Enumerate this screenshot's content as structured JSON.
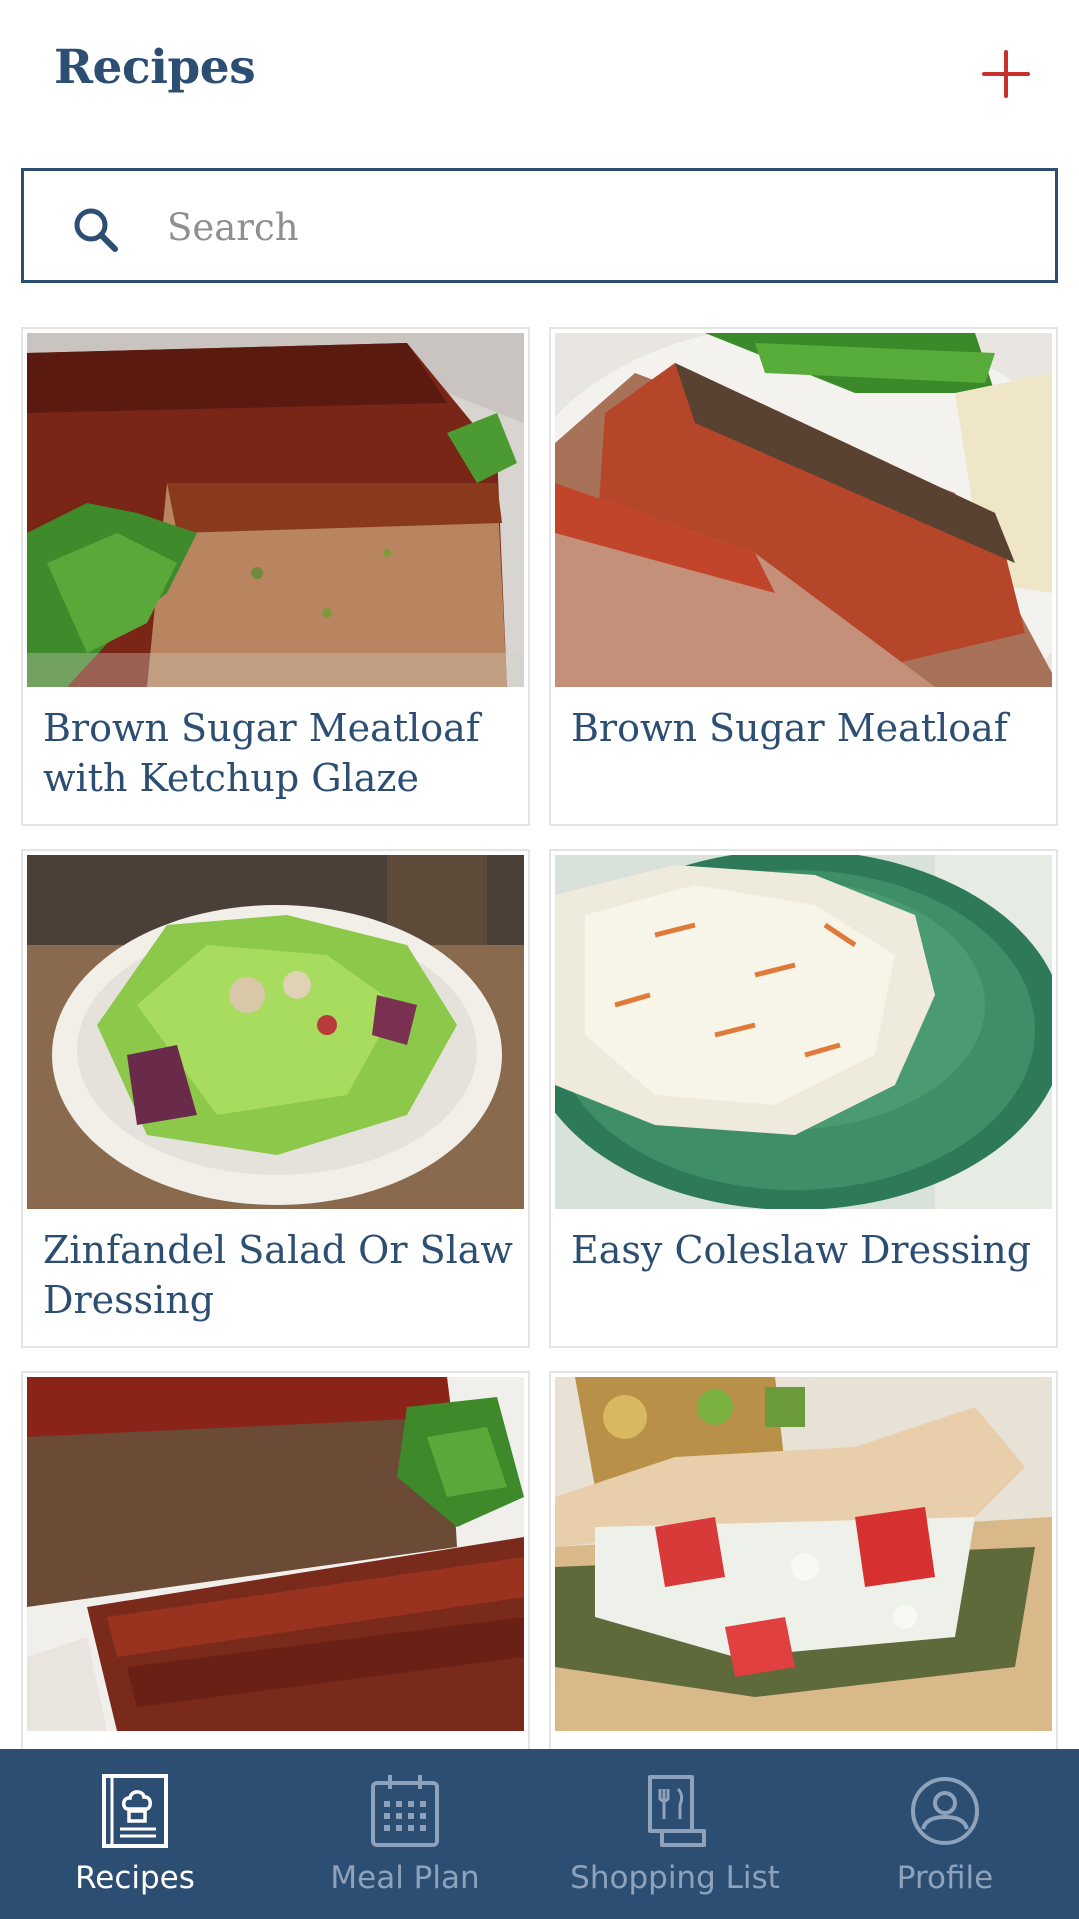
{
  "header": {
    "title": "Recipes",
    "add_icon": "plus-icon",
    "accent_color": "#c8302e"
  },
  "search": {
    "placeholder": "Search",
    "value": "",
    "icon": "search-icon"
  },
  "recipes": [
    {
      "title": "Brown Sugar Meatloaf with Ketchup Glaze",
      "image": "meatloaf-with-parsley"
    },
    {
      "title": "Brown Sugar Meatloaf",
      "image": "sliced-meatloaf-with-green-beans"
    },
    {
      "title": "Zinfandel Salad Or Slaw Dressing",
      "image": "green-salad-bowl"
    },
    {
      "title": "Easy Coleslaw Dressing",
      "image": "coleslaw-on-green-plate"
    },
    {
      "title": "",
      "image": "glazed-meatloaf-slices"
    },
    {
      "title": "",
      "image": "pita-wrap-with-tomato-and-feta"
    }
  ],
  "tabbar": {
    "background": "#2c4e73",
    "tabs": [
      {
        "label": "Recipes",
        "icon": "recipe-book-icon",
        "active": true
      },
      {
        "label": "Meal Plan",
        "icon": "calendar-icon",
        "active": false
      },
      {
        "label": "Shopping List",
        "icon": "receipt-icon",
        "active": false
      },
      {
        "label": "Profile",
        "icon": "profile-icon",
        "active": false
      }
    ]
  }
}
